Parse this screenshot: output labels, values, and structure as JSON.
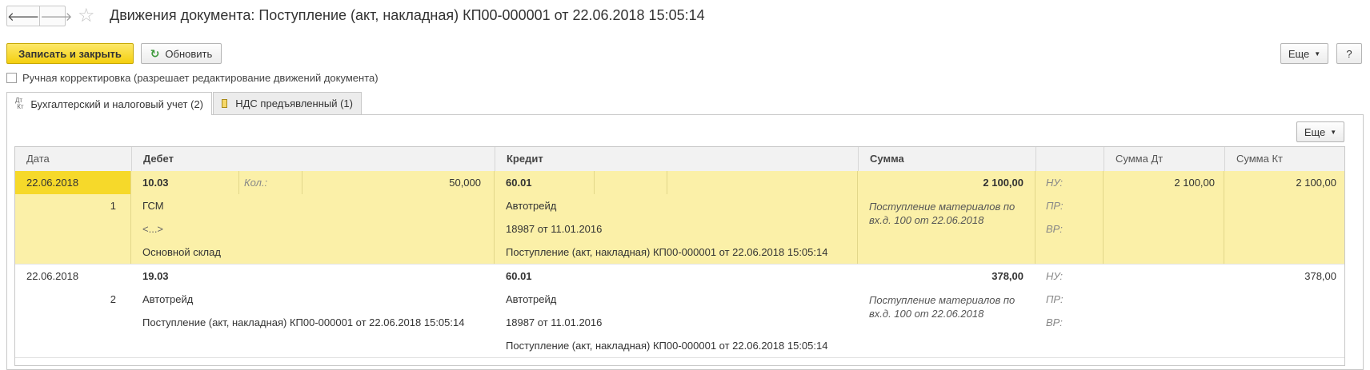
{
  "window": {
    "title": "Движения документа: Поступление (акт, накладная) КП00-000001 от 22.06.2018 15:05:14",
    "back_icon": "arrow-left-icon",
    "forward_icon": "arrow-right-icon",
    "favorite_icon": "star-icon"
  },
  "toolbar": {
    "save_close": "Записать и закрыть",
    "refresh": "Обновить",
    "more": "Еще",
    "help": "?"
  },
  "manual_edit_label": "Ручная корректировка (разрешает редактирование движений документа)",
  "tabs": [
    {
      "label": "Бухгалтерский и налоговый учет (2)",
      "icon": "dt-kt-icon"
    },
    {
      "label": "НДС предъявленный (1)",
      "icon": "register-icon"
    }
  ],
  "grid": {
    "more": "Еще",
    "columns": {
      "date": "Дата",
      "debit": "Дебет",
      "credit": "Кредит",
      "sum": "Сумма",
      "sum_dt": "Сумма Дт",
      "sum_kt": "Сумма Кт"
    },
    "rows": [
      {
        "date": "22.06.2018",
        "num": "1",
        "debit_account": "10.03",
        "qty_label": "Кол.:",
        "qty": "50,000",
        "debit_sub1": "ГСМ",
        "debit_sub2": "<...>",
        "debit_sub3": "Основной склад",
        "credit_account": "60.01",
        "credit_sub1": "Автотрейд",
        "credit_sub2": "18987 от 11.01.2016",
        "credit_sub3": "Поступление (акт, накладная) КП00-000001 от 22.06.2018 15:05:14",
        "sum": "2 100,00",
        "description": "Поступление материалов по вх.д. 100 от 22.06.2018",
        "nu": "НУ:",
        "pr": "ПР:",
        "vr": "ВР:",
        "nu_dt": "2 100,00",
        "nu_kt": "2 100,00"
      },
      {
        "date": "22.06.2018",
        "num": "2",
        "debit_account": "19.03",
        "debit_sub1": "Автотрейд",
        "debit_sub2": "Поступление (акт, накладная) КП00-000001 от 22.06.2018 15:05:14",
        "credit_account": "60.01",
        "credit_sub1": "Автотрейд",
        "credit_sub2": "18987 от 11.01.2016",
        "credit_sub3": "Поступление (акт, накладная) КП00-000001 от 22.06.2018 15:05:14",
        "sum": "378,00",
        "description": "Поступление материалов по вх.д. 100 от 22.06.2018",
        "nu": "НУ:",
        "pr": "ПР:",
        "vr": "ВР:",
        "nu_kt": "378,00"
      }
    ]
  }
}
